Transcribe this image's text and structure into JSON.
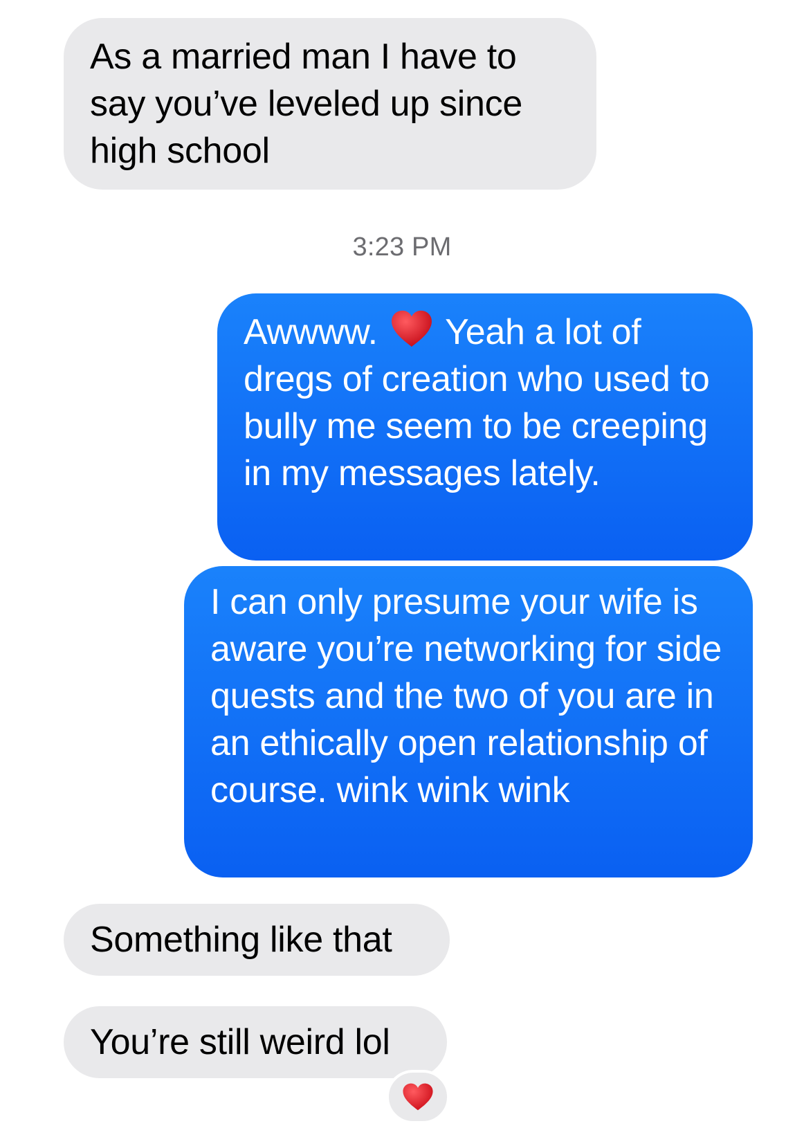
{
  "messages": [
    {
      "direction": "incoming",
      "text": "As a married man I have to say you’ve leveled up since high school"
    },
    {
      "direction": "outgoing",
      "text_before_emoji": "Awwww.",
      "emoji": "red-heart",
      "text_after_emoji": "Yeah a lot of dregs of creation who used to bully me seem to be creeping in my messages lately."
    },
    {
      "direction": "outgoing",
      "text": "I can only presume your wife is aware you’re networking for side quests and the two of you are in an ethically open relationship of course. wink wink wink"
    },
    {
      "direction": "incoming",
      "text": "Something like that"
    },
    {
      "direction": "incoming",
      "text": "You’re still weird lol",
      "reaction": "heart"
    }
  ],
  "timestamp": "3:23 PM",
  "colors": {
    "incoming_bg": "#e9e9eb",
    "outgoing_bg": "#0a6cf6",
    "heart": "#e0202a",
    "timestamp_text": "#6c6c70"
  }
}
